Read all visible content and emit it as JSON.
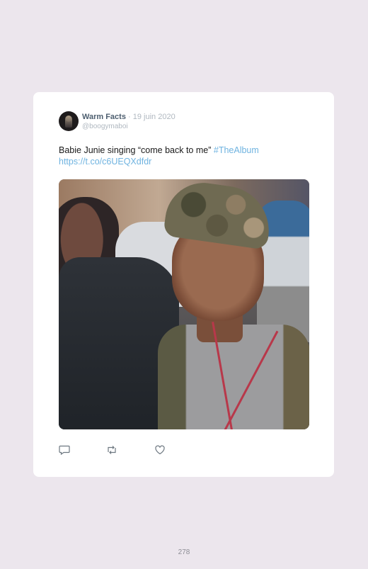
{
  "tweet": {
    "display_name": "Warm Facts",
    "separator": "·",
    "date": "19 juin 2020",
    "handle": "@boogymaboi",
    "text": "Babie Junie singing “come back to me” ",
    "hashtag": "#TheAlbum",
    "link": "https://t.co/c6UEQXdfdr"
  },
  "actions": {
    "reply_icon": "comment-icon",
    "retweet_icon": "retweet-icon",
    "like_icon": "heart-icon"
  },
  "page": {
    "number": "278"
  },
  "colors": {
    "background": "#ece6ed",
    "card": "#ffffff",
    "name": "#4d5e6f",
    "muted": "#b0b8c0",
    "link": "#6fb3e0"
  }
}
